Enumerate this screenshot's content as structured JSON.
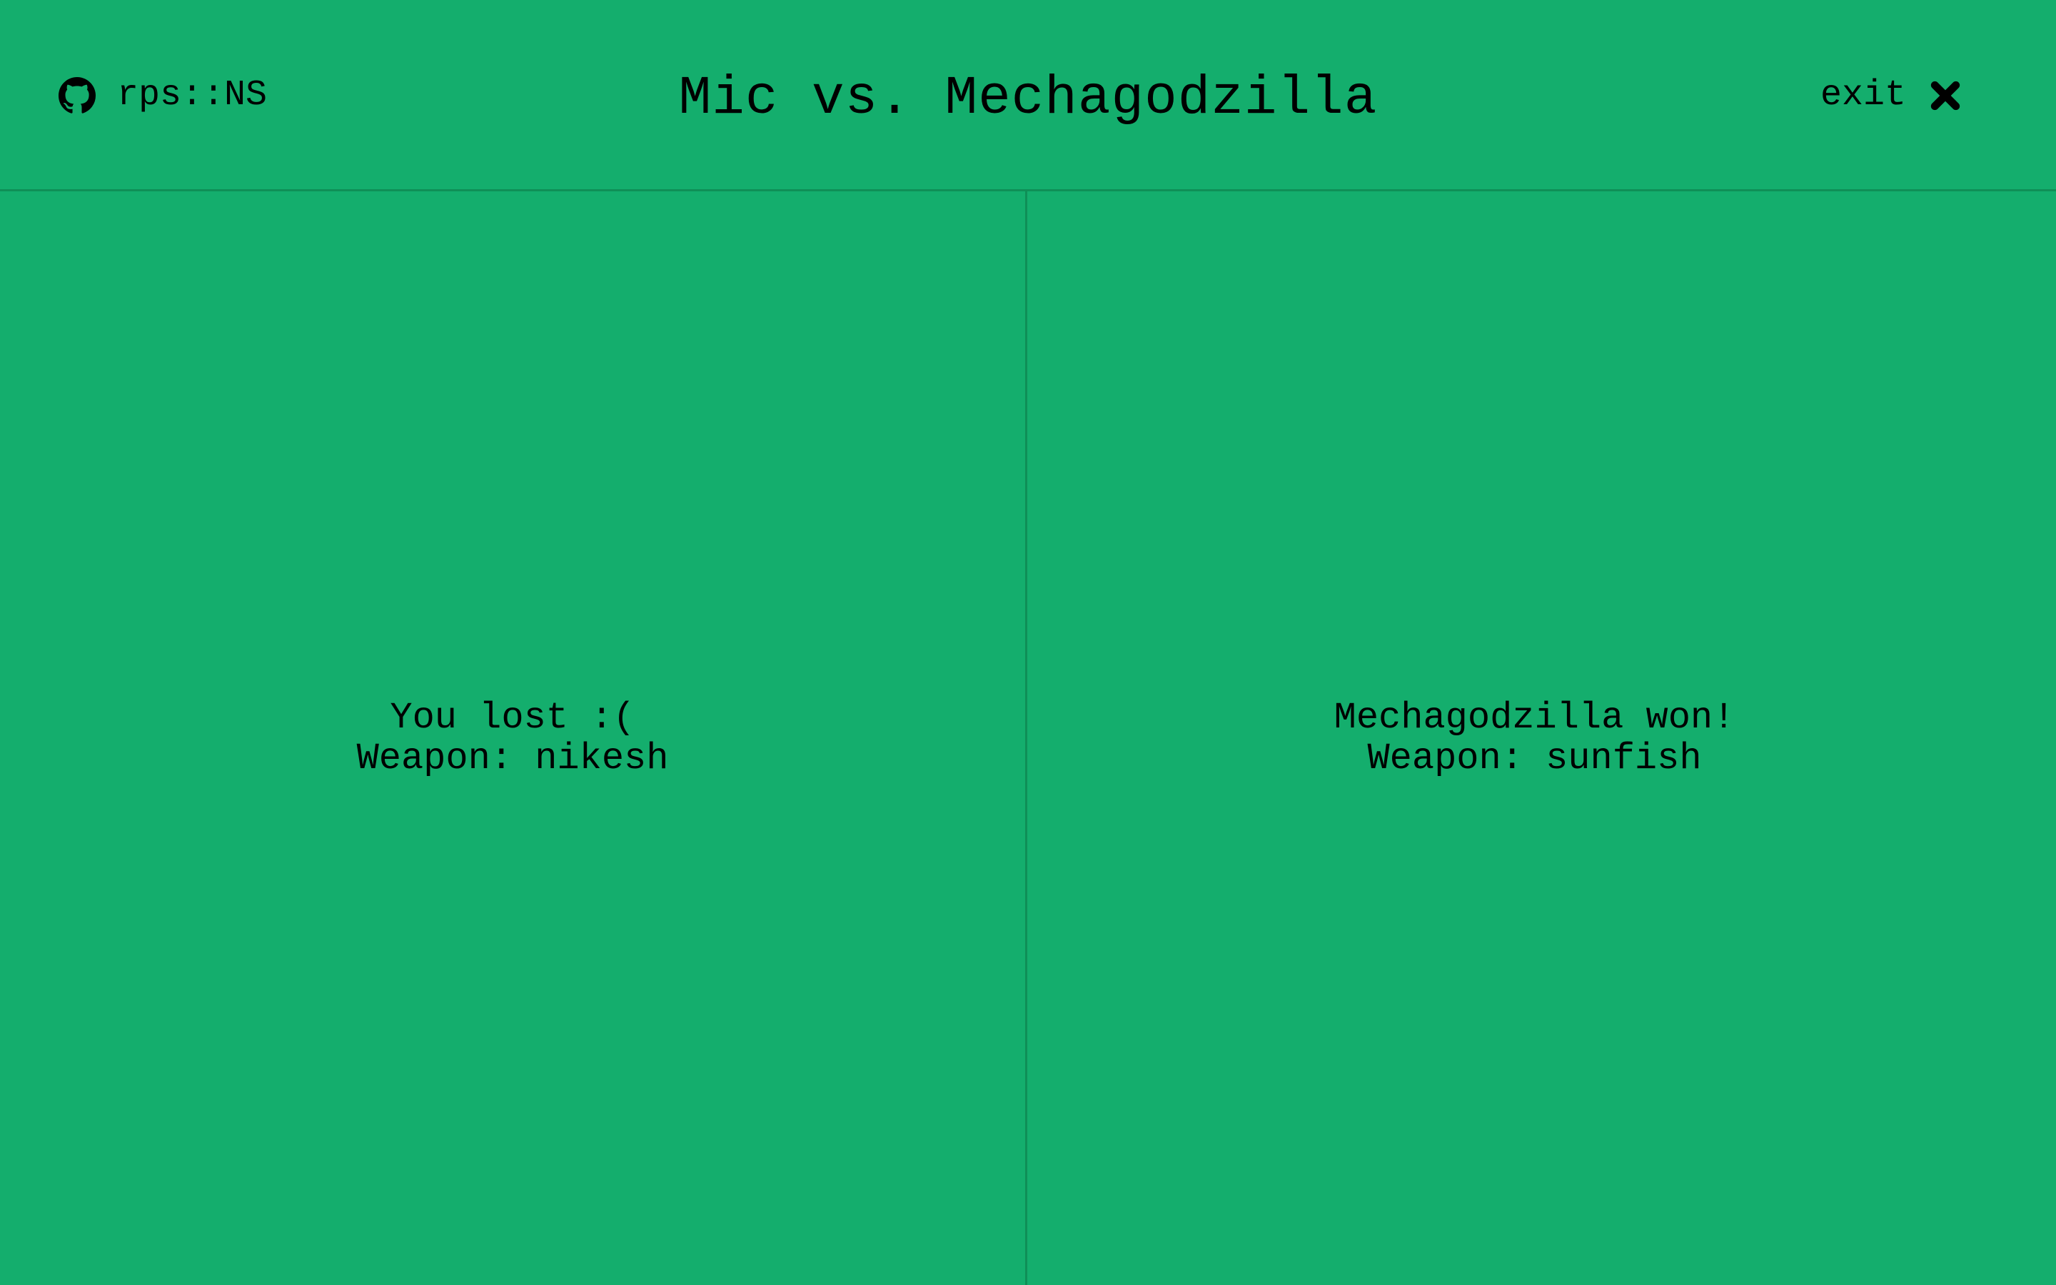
{
  "header": {
    "brand_icon": "github-icon",
    "brand_label": "rps::NS",
    "title": "Mic vs. Mechagodzilla",
    "exit_label": "exit",
    "exit_icon": "close-icon"
  },
  "panels": {
    "player": {
      "status": "You lost :(",
      "weapon": "Weapon: nikesh"
    },
    "opponent": {
      "status": "Mechagodzilla won!",
      "weapon": "Weapon: sunfish"
    }
  },
  "colors": {
    "background": "#14ae6d",
    "divider": "#0f8f57",
    "text": "#000000"
  }
}
